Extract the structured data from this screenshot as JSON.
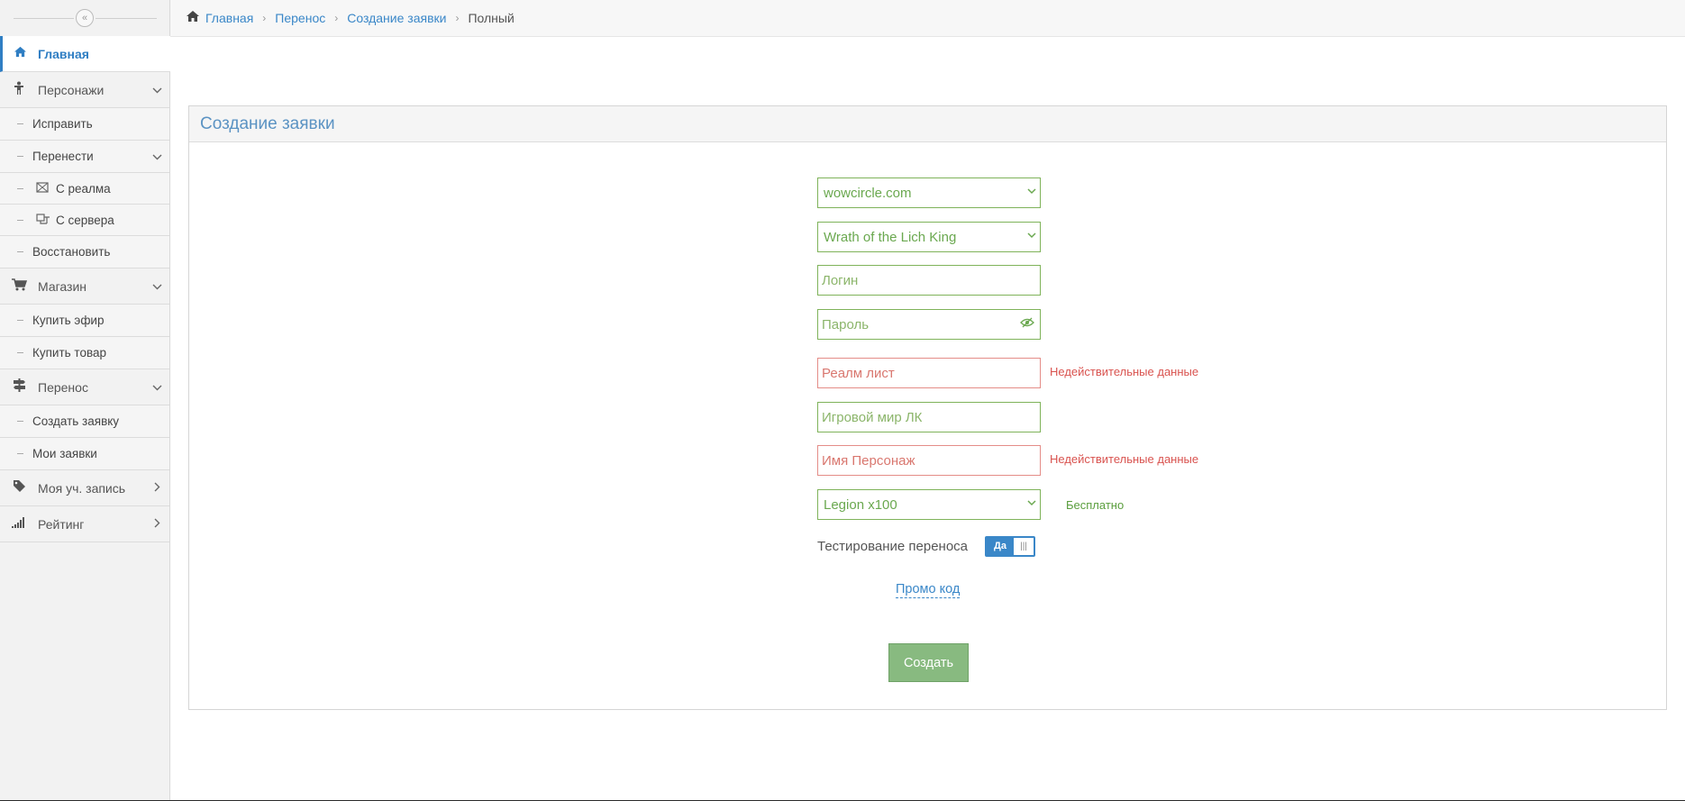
{
  "sidebar": {
    "collapse_icon": "«",
    "items": {
      "home": {
        "label": "Главная",
        "icon": "home-icon"
      },
      "characters": {
        "label": "Персонажи",
        "icon": "character-icon"
      },
      "fix": {
        "label": "Исправить"
      },
      "move": {
        "label": "Перенести"
      },
      "from_realm": {
        "label": "С реалма",
        "icon": "realm-icon"
      },
      "from_server": {
        "label": "С сервера",
        "icon": "server-icon"
      },
      "restore": {
        "label": "Восстановить"
      },
      "shop": {
        "label": "Магазин",
        "icon": "cart-icon"
      },
      "buy_ether": {
        "label": "Купить эфир"
      },
      "buy_item": {
        "label": "Купить товар"
      },
      "transfer": {
        "label": "Перенос",
        "icon": "signpost-icon"
      },
      "create_request": {
        "label": "Создать заявку"
      },
      "my_requests": {
        "label": "Мои заявки"
      },
      "account": {
        "label": "Моя уч. запись",
        "icon": "tag-icon"
      },
      "rating": {
        "label": "Рейтинг",
        "icon": "signal-icon"
      }
    }
  },
  "breadcrumb": {
    "items": [
      "Главная",
      "Перенос",
      "Создание заявки"
    ],
    "current": "Полный"
  },
  "panel": {
    "title": "Создание заявки"
  },
  "form": {
    "server_select": "wowcircle.com",
    "expansion_select": "Wrath of the Lich King",
    "login_placeholder": "Логин",
    "password_placeholder": "Пароль",
    "realmlist_placeholder": "Реалм лист",
    "realmlist_error": "Недействительные данные",
    "game_world_placeholder": "Игровой мир ЛК",
    "character_placeholder": "Имя Персонаж",
    "character_error": "Недействительные данные",
    "target_select": "Legion x100",
    "target_note": "Бесплатно",
    "testing_label": "Тестирование переноса",
    "testing_toggle_on": "Да",
    "promo_link": "Промо код",
    "submit_label": "Создать"
  },
  "colors": {
    "accent": "#3a87c8",
    "valid": "#7fb35a",
    "invalid": "#e48d88",
    "submit": "#88ba80"
  }
}
